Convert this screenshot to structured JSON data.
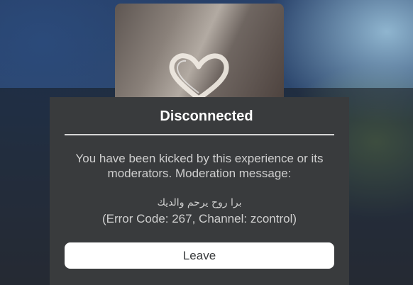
{
  "dialog": {
    "title": "Disconnected",
    "message": "You have been kicked by this experience or its moderators. Moderation message:",
    "moderation_message": "برا روح يرحم والديك",
    "error_line": "(Error Code: 267, Channel: zcontrol)",
    "leave_label": "Leave"
  },
  "thumbnail": {
    "icon": "heart-icon"
  },
  "colors": {
    "dialog_bg": "#393b3d",
    "title_text": "#ffffff",
    "body_text": "#cfcfcf",
    "button_bg": "#ffffff",
    "button_text": "#393b3d",
    "divider": "#d6d6d6"
  }
}
